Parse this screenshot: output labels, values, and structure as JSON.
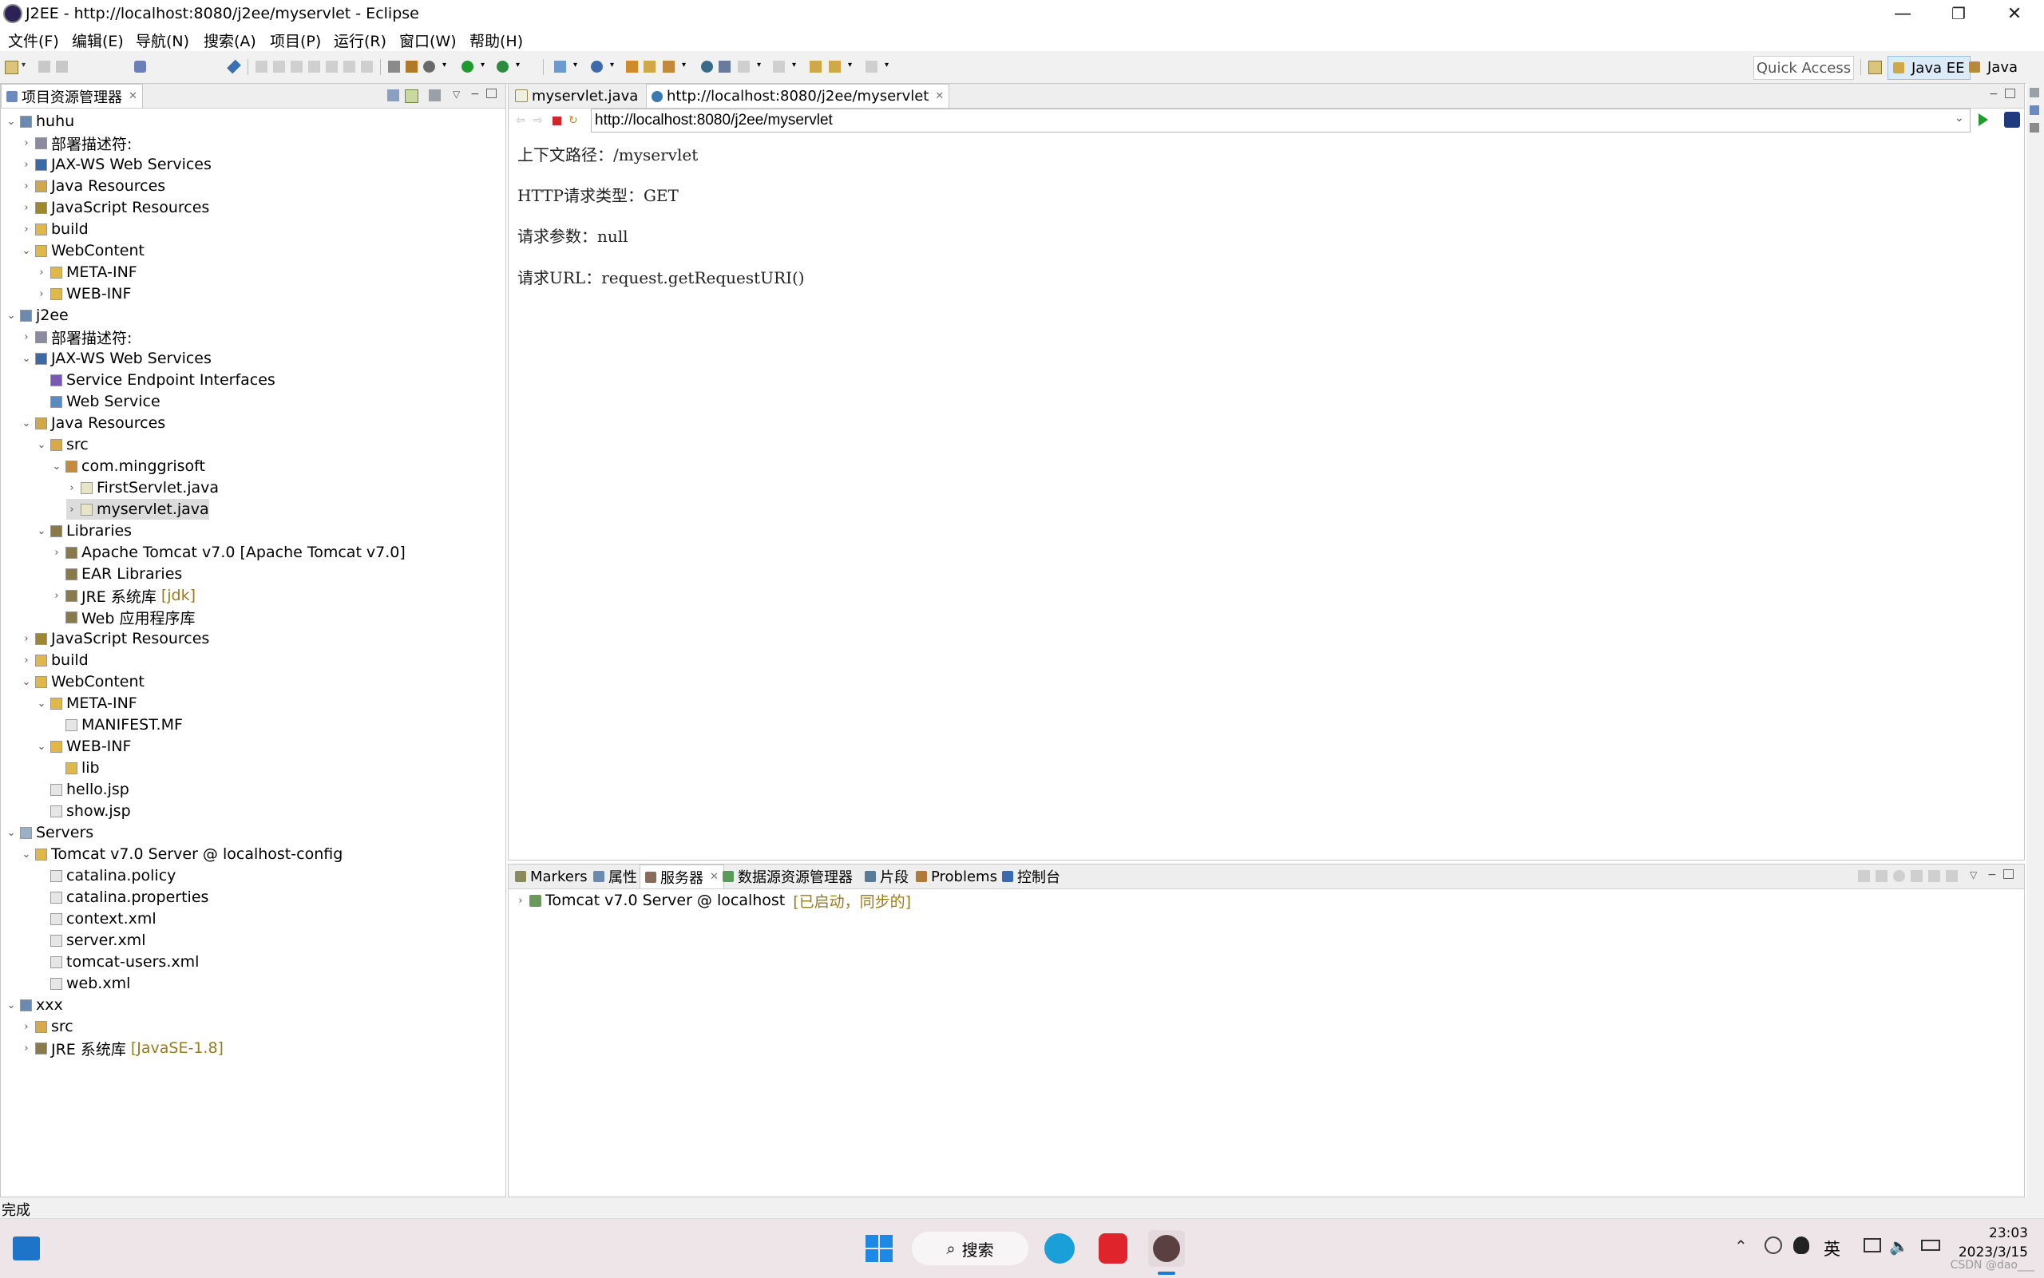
{
  "window": {
    "title": "J2EE - http://localhost:8080/j2ee/myservlet - Eclipse",
    "minimize": "—",
    "restore": "❐",
    "close": "✕"
  },
  "menu": [
    "文件(F)",
    "编辑(E)",
    "导航(N)",
    "搜索(A)",
    "项目(P)",
    "运行(R)",
    "窗口(W)",
    "帮助(H)"
  ],
  "toolbar": {
    "quick_access": "Quick Access",
    "perspectives": [
      "Java EE",
      "Java"
    ]
  },
  "explorer": {
    "tab_label": "项目资源管理器",
    "tree": [
      {
        "label": "huhu",
        "level": 0,
        "tw": "v",
        "icon": "web-project-icon"
      },
      {
        "label": "部署描述符:",
        "level": 1,
        "tw": ">",
        "icon": "deployment-descriptor-icon"
      },
      {
        "label": "JAX-WS Web Services",
        "level": 1,
        "tw": ">",
        "icon": "web-services-icon"
      },
      {
        "label": "Java Resources",
        "level": 1,
        "tw": ">",
        "icon": "java-resources-icon"
      },
      {
        "label": "JavaScript Resources",
        "level": 1,
        "tw": ">",
        "icon": "javascript-resources-icon"
      },
      {
        "label": "build",
        "level": 1,
        "tw": ">",
        "icon": "folder-icon"
      },
      {
        "label": "WebContent",
        "level": 1,
        "tw": "v",
        "icon": "folder-icon"
      },
      {
        "label": "META-INF",
        "level": 2,
        "tw": ">",
        "icon": "folder-icon"
      },
      {
        "label": "WEB-INF",
        "level": 2,
        "tw": ">",
        "icon": "folder-icon"
      },
      {
        "label": "j2ee",
        "level": 0,
        "tw": "v",
        "icon": "web-project-icon"
      },
      {
        "label": "部署描述符:",
        "level": 1,
        "tw": ">",
        "icon": "deployment-descriptor-icon"
      },
      {
        "label": "JAX-WS Web Services",
        "level": 1,
        "tw": "v",
        "icon": "web-services-icon"
      },
      {
        "label": "Service Endpoint Interfaces",
        "level": 2,
        "tw": "",
        "icon": "interface-icon"
      },
      {
        "label": "Web Service",
        "level": 2,
        "tw": "",
        "icon": "web-service-icon"
      },
      {
        "label": "Java Resources",
        "level": 1,
        "tw": "v",
        "icon": "java-resources-icon"
      },
      {
        "label": "src",
        "level": 2,
        "tw": "v",
        "icon": "source-folder-icon"
      },
      {
        "label": "com.minggrisoft",
        "level": 3,
        "tw": "v",
        "icon": "package-icon"
      },
      {
        "label": "FirstServlet.java",
        "level": 4,
        "tw": ">",
        "icon": "java-file-icon"
      },
      {
        "label": "myservlet.java",
        "level": 4,
        "tw": ">",
        "icon": "java-file-icon",
        "selected": true
      },
      {
        "label": "Libraries",
        "level": 2,
        "tw": "v",
        "icon": "library-icon"
      },
      {
        "label": "Apache Tomcat v7.0 [Apache Tomcat v7.0]",
        "level": 3,
        "tw": ">",
        "icon": "library-icon"
      },
      {
        "label": "EAR Libraries",
        "level": 3,
        "tw": "",
        "icon": "library-icon"
      },
      {
        "label": "JRE 系统库",
        "level": 3,
        "tw": ">",
        "icon": "library-icon",
        "deco": "[jdk]"
      },
      {
        "label": "Web 应用程序库",
        "level": 3,
        "tw": "",
        "icon": "library-icon"
      },
      {
        "label": "JavaScript Resources",
        "level": 1,
        "tw": ">",
        "icon": "javascript-resources-icon"
      },
      {
        "label": "build",
        "level": 1,
        "tw": ">",
        "icon": "folder-icon"
      },
      {
        "label": "WebContent",
        "level": 1,
        "tw": "v",
        "icon": "folder-icon"
      },
      {
        "label": "META-INF",
        "level": 2,
        "tw": "v",
        "icon": "folder-icon"
      },
      {
        "label": "MANIFEST.MF",
        "level": 3,
        "tw": "",
        "icon": "file-icon"
      },
      {
        "label": "WEB-INF",
        "level": 2,
        "tw": "v",
        "icon": "folder-icon"
      },
      {
        "label": "lib",
        "level": 3,
        "tw": "",
        "icon": "folder-icon"
      },
      {
        "label": "hello.jsp",
        "level": 2,
        "tw": "",
        "icon": "jsp-file-icon"
      },
      {
        "label": "show.jsp",
        "level": 2,
        "tw": "",
        "icon": "jsp-file-icon"
      },
      {
        "label": "Servers",
        "level": 0,
        "tw": "v",
        "icon": "servers-folder-icon"
      },
      {
        "label": "Tomcat v7.0 Server @ localhost-config",
        "level": 1,
        "tw": "v",
        "icon": "folder-icon"
      },
      {
        "label": "catalina.policy",
        "level": 2,
        "tw": "",
        "icon": "file-icon"
      },
      {
        "label": "catalina.properties",
        "level": 2,
        "tw": "",
        "icon": "file-icon"
      },
      {
        "label": "context.xml",
        "level": 2,
        "tw": "",
        "icon": "xml-file-icon"
      },
      {
        "label": "server.xml",
        "level": 2,
        "tw": "",
        "icon": "xml-file-icon"
      },
      {
        "label": "tomcat-users.xml",
        "level": 2,
        "tw": "",
        "icon": "xml-file-icon"
      },
      {
        "label": "web.xml",
        "level": 2,
        "tw": "",
        "icon": "xml-file-icon"
      },
      {
        "label": "xxx",
        "level": 0,
        "tw": "v",
        "icon": "java-project-icon"
      },
      {
        "label": "src",
        "level": 1,
        "tw": ">",
        "icon": "source-folder-icon"
      },
      {
        "label": "JRE 系统库",
        "level": 1,
        "tw": ">",
        "icon": "library-icon",
        "deco": "[JavaSE-1.8]"
      }
    ]
  },
  "editor": {
    "tabs": [
      {
        "label": "myservlet.java"
      },
      {
        "label": "http://localhost:8080/j2ee/myservlet"
      }
    ],
    "url": "http://localhost:8080/j2ee/myservlet",
    "content_lines": [
      "上下文路径：/myservlet",
      "HTTP请求类型：GET",
      "请求参数：null",
      "请求URL：request.getRequestURI()"
    ]
  },
  "bottom": {
    "tabs": [
      "Markers",
      "属性",
      "服务器",
      "数据源资源管理器",
      "片段",
      "Problems",
      "控制台"
    ],
    "server_name": "Tomcat v7.0 Server @ localhost",
    "server_status": "[已启动，同步的]"
  },
  "status": {
    "text": "完成"
  },
  "taskbar": {
    "search_label": "搜索",
    "ime": "英",
    "time": "23:03",
    "date": "2023/3/15",
    "watermark": "CSDN @dao___"
  },
  "colors": {
    "accent_selected_tab": "#dcebf8",
    "decoration": "#9a7a1a",
    "run_green": "#1f9a2e",
    "stop_red": "#d0262b"
  }
}
